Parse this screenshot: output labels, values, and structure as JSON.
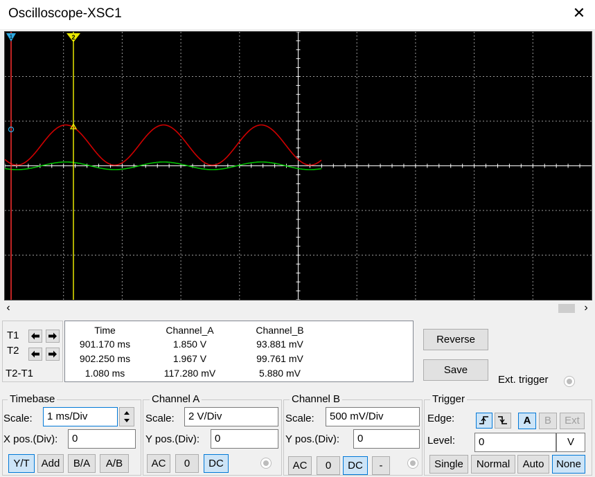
{
  "window": {
    "title": "Oscilloscope-XSC1"
  },
  "icons": {
    "close": "close-icon",
    "scroll_left": "chevron-left-icon",
    "scroll_right": "chevron-right-icon",
    "arrow_left": "arrow-left-icon",
    "arrow_right": "arrow-right-icon",
    "rising_edge": "rising-edge-icon",
    "falling_edge": "falling-edge-icon"
  },
  "colors": {
    "screen_bg": "#000000",
    "grid": "#9a9a9a",
    "channel_a": "#d00000",
    "channel_b": "#00c000",
    "cursor_t1": "#ff3030",
    "cursor_t2": "#e8e800",
    "marker_t1": "#2fa8e0",
    "selected_border": "#0078d7"
  },
  "screen": {
    "cursor_t1_label": "1",
    "cursor_t2_label": "2"
  },
  "cursors": {
    "t1_label": "T1",
    "t2_label": "T2",
    "diff_label": "T2-T1"
  },
  "measurements": {
    "headers": [
      "Time",
      "Channel_A",
      "Channel_B"
    ],
    "rows": [
      [
        "901.170 ms",
        "1.850 V",
        "93.881 mV"
      ],
      [
        "902.250 ms",
        "1.967 V",
        "99.761 mV"
      ],
      [
        "1.080 ms",
        "117.280 mV",
        "5.880 mV"
      ]
    ]
  },
  "buttons": {
    "reverse": "Reverse",
    "save": "Save",
    "ext_trigger": "Ext. trigger"
  },
  "timebase": {
    "title": "Timebase",
    "scale_label": "Scale:",
    "scale_value": "1 ms/Div",
    "xpos_label": "X pos.(Div):",
    "xpos_value": "0",
    "modes": [
      "Y/T",
      "Add",
      "B/A",
      "A/B"
    ]
  },
  "channel_a": {
    "title": "Channel A",
    "scale_label": "Scale:",
    "scale_value": "2  V/Div",
    "ypos_label": "Y pos.(Div):",
    "ypos_value": "0",
    "coupling": [
      "AC",
      "0",
      "DC"
    ]
  },
  "channel_b": {
    "title": "Channel B",
    "scale_label": "Scale:",
    "scale_value": "500 mV/Div",
    "ypos_label": "Y pos.(Div):",
    "ypos_value": "0",
    "coupling": [
      "AC",
      "0",
      "DC",
      "-"
    ]
  },
  "trigger": {
    "title": "Trigger",
    "edge_label": "Edge:",
    "sources": [
      "A",
      "B",
      "Ext"
    ],
    "level_label": "Level:",
    "level_value": "0",
    "level_unit": "V",
    "modes": [
      "Single",
      "Normal",
      "Auto",
      "None"
    ]
  }
}
